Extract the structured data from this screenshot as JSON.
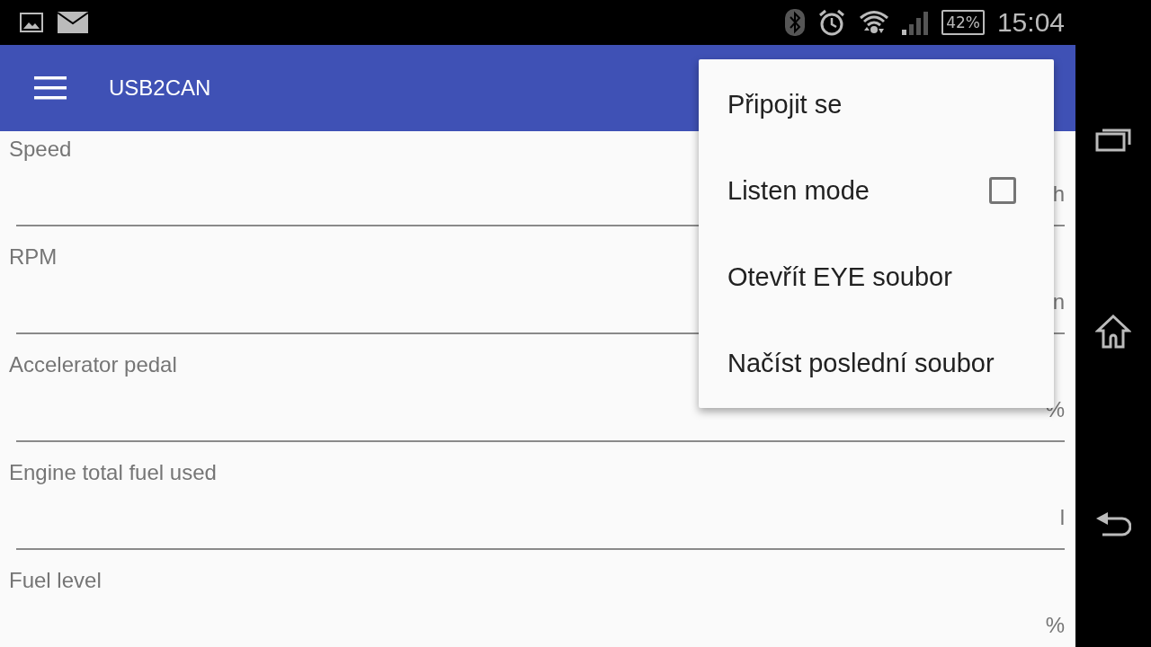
{
  "status_bar": {
    "battery": "42%",
    "time": "15:04"
  },
  "toolbar": {
    "title": "USB2CAN"
  },
  "fields": [
    {
      "label": "Speed",
      "unit": "h"
    },
    {
      "label": "RPM",
      "unit": "n"
    },
    {
      "label": "Accelerator pedal",
      "unit": "%"
    },
    {
      "label": "Engine total fuel used",
      "unit": "l"
    },
    {
      "label": "Fuel level",
      "unit": "%"
    }
  ],
  "menu": {
    "items": [
      {
        "kind": "action",
        "label": "Připojit se"
      },
      {
        "kind": "checkbox",
        "label": "Listen mode",
        "checked": false
      },
      {
        "kind": "action",
        "label": "Otevřít EYE soubor"
      },
      {
        "kind": "action",
        "label": "Načíst poslední soubor"
      }
    ]
  }
}
